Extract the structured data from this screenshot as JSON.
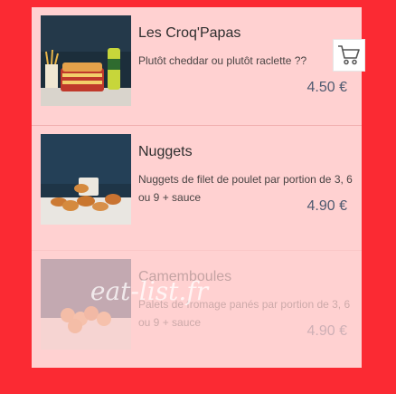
{
  "menu": {
    "items": [
      {
        "name": "Les Croq'Papas",
        "description": "Plutôt cheddar ou plutôt raclette ??",
        "price": "4.50 €",
        "available": true
      },
      {
        "name": "Nuggets",
        "description": "Nuggets de filet de poulet par portion de 3, 6 ou 9 + sauce",
        "price": "4.90 €",
        "available": true
      },
      {
        "name": "Camemboules",
        "description": "Palets de fromage panés par portion de 3, 6 ou 9 + sauce",
        "price": "4.90 €",
        "available": false
      }
    ]
  },
  "cart_button": {
    "icon": "shopping-cart-icon"
  },
  "watermark": {
    "text": "eat-list.fr"
  },
  "colors": {
    "background": "#fb2a33",
    "panel": "#ffd1d1",
    "price": "#4f5a70"
  }
}
